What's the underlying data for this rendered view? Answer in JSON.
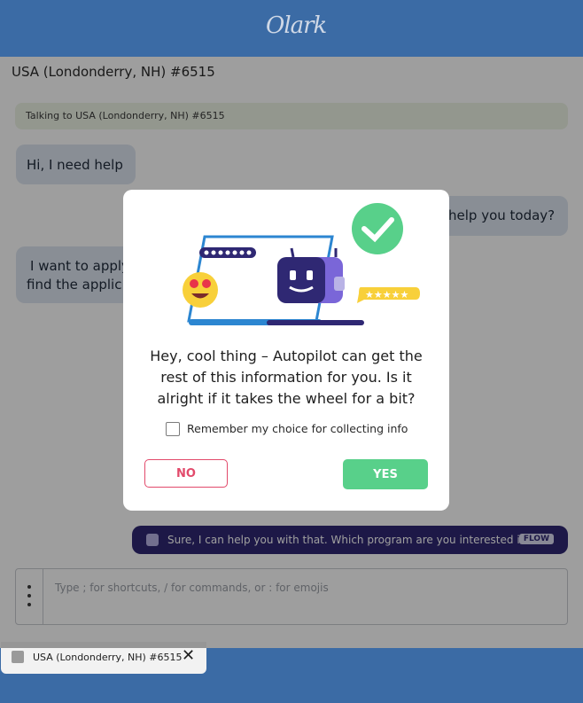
{
  "app": {
    "logo": "Olark"
  },
  "conversation": {
    "title": "USA (Londonderry, NH) #6515",
    "banner": "Talking to USA (Londonderry, NH) #6515",
    "messages": [
      {
        "from": "visitor",
        "text": "Hi, I need help"
      },
      {
        "from": "operator",
        "text": "help you today?"
      },
      {
        "from": "visitor",
        "line1": "I want to apply",
        "line2": "find the applic"
      }
    ],
    "flow_message": {
      "text": "Sure, I can help you with that. Which program are you interested in?",
      "tag": "FLOW"
    }
  },
  "composer": {
    "placeholder": "Type ; for shortcuts, / for commands, or : for emojis"
  },
  "footer_tab": {
    "label": "USA (Londonderry, NH) #6515"
  },
  "modal": {
    "question_line1": "Hey, cool thing – Autopilot can get the",
    "question_line2": "rest of this information for you. Is it",
    "question_line3": "alright if it takes the wheel for a bit?",
    "checkbox_label": "Remember my choice for collecting info",
    "checkbox_checked": false,
    "no_label": "NO",
    "yes_label": "YES"
  },
  "colors": {
    "header": "#3b6ba5",
    "flow_bubble": "#2f2873",
    "yes": "#58d08a",
    "no": "#e24a6b"
  }
}
